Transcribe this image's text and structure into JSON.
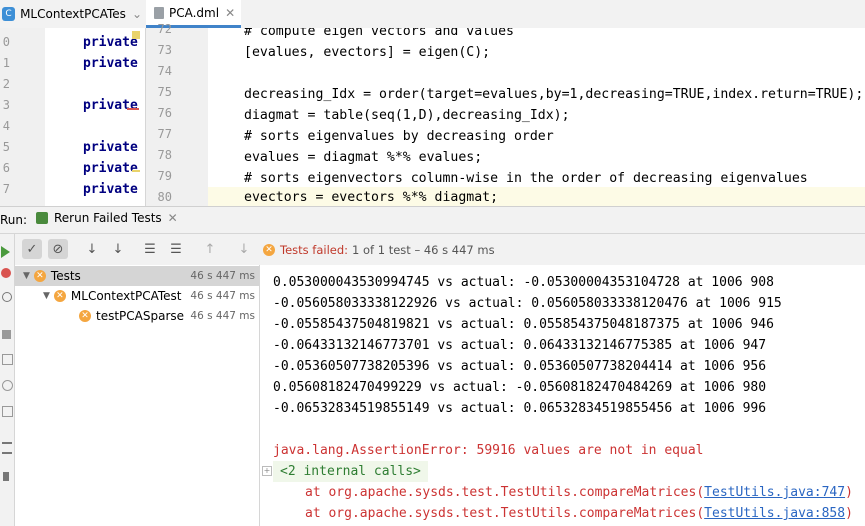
{
  "tabs": [
    {
      "label": "MLContextPCATes",
      "icon": "C"
    },
    {
      "label": "PCA.dml",
      "icon": "file"
    }
  ],
  "left_editor": {
    "line_numbers": [
      "0",
      "1",
      "2",
      "3",
      "4",
      "5",
      "6",
      "7"
    ],
    "lines": [
      "private",
      "private",
      "",
      "private",
      "",
      "private",
      "private",
      "private"
    ]
  },
  "editor": {
    "line_numbers": [
      "72",
      "73",
      "74",
      "75",
      "76",
      "77",
      "78",
      "79",
      "80"
    ],
    "lines": [
      "# compute eigen vectors and values",
      "[evalues, evectors] = eigen(C);",
      "",
      "decreasing_Idx = order(target=evalues,by=1,decreasing=TRUE,index.return=TRUE);",
      "diagmat = table(seq(1,D),decreasing_Idx);",
      "# sorts eigenvalues by decreasing order",
      "evalues = diagmat %*% evalues;",
      "# sorts eigenvectors column-wise in the order of decreasing eigenvalues",
      "evectors = evectors %*% diagmat;"
    ]
  },
  "run": {
    "label": "Run:",
    "tab_label": "Rerun Failed Tests",
    "status_prefix": "Tests failed:",
    "status_detail": "1 of 1 test – 46 s 447 ms"
  },
  "tree": [
    {
      "label": "Tests",
      "time": "46 s 447 ms",
      "level": 0
    },
    {
      "label": "MLContextPCATest",
      "time": "46 s 447 ms",
      "level": 1
    },
    {
      "label": "testPCASparse",
      "time": "46 s 447 ms",
      "level": 2
    }
  ],
  "console": {
    "lines": [
      "0.053000043530994745 vs actual: -0.05300004353104728 at 1006 908",
      "-0.056058033338122926 vs actual: 0.056058033338120476 at 1006 915",
      "-0.05585437504819821 vs actual: 0.055854375048187375 at 1006 946",
      "-0.06433132146773701 vs actual: 0.06433132146775385 at 1006 947",
      "-0.05360507738205396 vs actual: 0.05360507738204414 at 1006 956",
      "0.05608182470499229 vs actual: -0.05608182470484269 at 1006 980",
      "-0.06532834519855149 vs actual: 0.06532834519855456 at 1006 996"
    ],
    "error": "java.lang.AssertionError: 59916 values are not in equal",
    "internal_calls": "<2 internal calls>",
    "stack": [
      {
        "prefix": "at org.apache.sysds.test.TestUtils.compareMatrices(",
        "link": "TestUtils.java:747",
        "suffix": ")"
      },
      {
        "prefix": "at org.apache.sysds.test.TestUtils.compareMatrices(",
        "link": "TestUtils.java:858",
        "suffix": ")"
      }
    ]
  },
  "colors": {
    "accent": "#4083c9",
    "fail": "#f4a640",
    "error_text": "#cc3333",
    "link": "#2a66c2"
  }
}
